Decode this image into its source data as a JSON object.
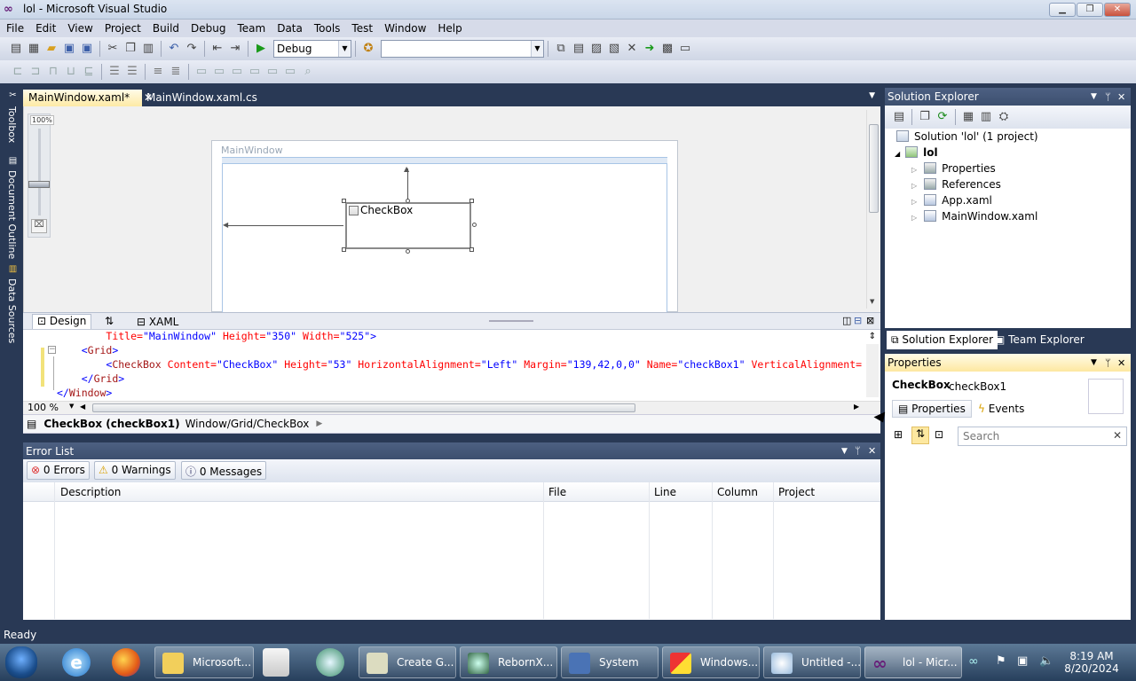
{
  "app": {
    "title": "lol - Microsoft Visual Studio",
    "window_buttons": [
      "minimize",
      "restore",
      "close"
    ]
  },
  "menu": [
    "File",
    "Edit",
    "View",
    "Project",
    "Build",
    "Debug",
    "Team",
    "Data",
    "Tools",
    "Test",
    "Window",
    "Help"
  ],
  "toolbar": {
    "config_value": "Debug",
    "platform_value": ""
  },
  "left_tabs": [
    "Toolbox",
    "Document Outline",
    "Data Sources"
  ],
  "doc_tabs": [
    {
      "label": "MainWindow.xaml*",
      "active": true
    },
    {
      "label": "MainWindow.xaml.cs",
      "active": false
    }
  ],
  "designer": {
    "zoom_label": "100%",
    "window_title": "MainWindow",
    "checkbox_label": "CheckBox"
  },
  "split": {
    "design_tab": "Design",
    "swap_icon": "⇅",
    "xaml_tab": "XAML"
  },
  "xaml_lines": [
    {
      "indent": "        ",
      "parts": [
        [
          "a",
          "Title="
        ],
        [
          "v",
          "\"MainWindow\" "
        ],
        [
          "a",
          "Height="
        ],
        [
          "v",
          "\"350\" "
        ],
        [
          "a",
          "Width="
        ],
        [
          "v",
          "\"525\">"
        ]
      ]
    },
    {
      "indent": "    ",
      "parts": [
        [
          "v",
          "<"
        ],
        [
          "t",
          "Grid"
        ],
        [
          "v",
          ">"
        ]
      ]
    },
    {
      "indent": "        ",
      "parts": [
        [
          "v",
          "<"
        ],
        [
          "t",
          "CheckBox "
        ],
        [
          "a",
          "Content="
        ],
        [
          "v",
          "\"CheckBox\" "
        ],
        [
          "a",
          "Height="
        ],
        [
          "v",
          "\"53\" "
        ],
        [
          "a",
          "HorizontalAlignment="
        ],
        [
          "v",
          "\"Left\" "
        ],
        [
          "a",
          "Margin="
        ],
        [
          "v",
          "\"139,42,0,0\" "
        ],
        [
          "a",
          "Name="
        ],
        [
          "v",
          "\"checkBox1\" "
        ],
        [
          "a",
          "VerticalAlignment="
        ]
      ]
    },
    {
      "indent": "    ",
      "parts": [
        [
          "v",
          "</"
        ],
        [
          "t",
          "Grid"
        ],
        [
          "v",
          ">"
        ]
      ]
    },
    {
      "indent": "",
      "parts": [
        [
          "v",
          "</"
        ],
        [
          "t",
          "Window"
        ],
        [
          "v",
          ">"
        ]
      ]
    }
  ],
  "editor": {
    "zoom": "100 %"
  },
  "breadcrumb": {
    "element": "CheckBox (checkBox1)",
    "path": "Window/Grid/CheckBox"
  },
  "error_list": {
    "title": "Error List",
    "errors": "0 Errors",
    "warnings": "0 Warnings",
    "messages": "0 Messages",
    "columns": [
      "Description",
      "File",
      "Line",
      "Column",
      "Project"
    ]
  },
  "solution_explorer": {
    "title": "Solution Explorer",
    "solution": "Solution 'lol' (1 project)",
    "project": "lol",
    "items": [
      "Properties",
      "References",
      "App.xaml",
      "MainWindow.xaml"
    ],
    "tabs": [
      "Solution Explorer",
      "Team Explorer"
    ]
  },
  "properties": {
    "title": "Properties",
    "type": "CheckBox",
    "name": "checkBox1",
    "tab_properties": "Properties",
    "tab_events": "Events",
    "search_placeholder": "Search"
  },
  "status": {
    "text": "Ready"
  },
  "taskbar": {
    "tasks": [
      "Microsoft...",
      "Create G...",
      "RebornX...",
      "System",
      "Windows...",
      "Untitled -...",
      "lol - Micr..."
    ],
    "time": "8:19 AM",
    "date": "8/20/2024"
  },
  "colors": {
    "accent": "#293955",
    "active_tab": "#fdeaa5"
  }
}
